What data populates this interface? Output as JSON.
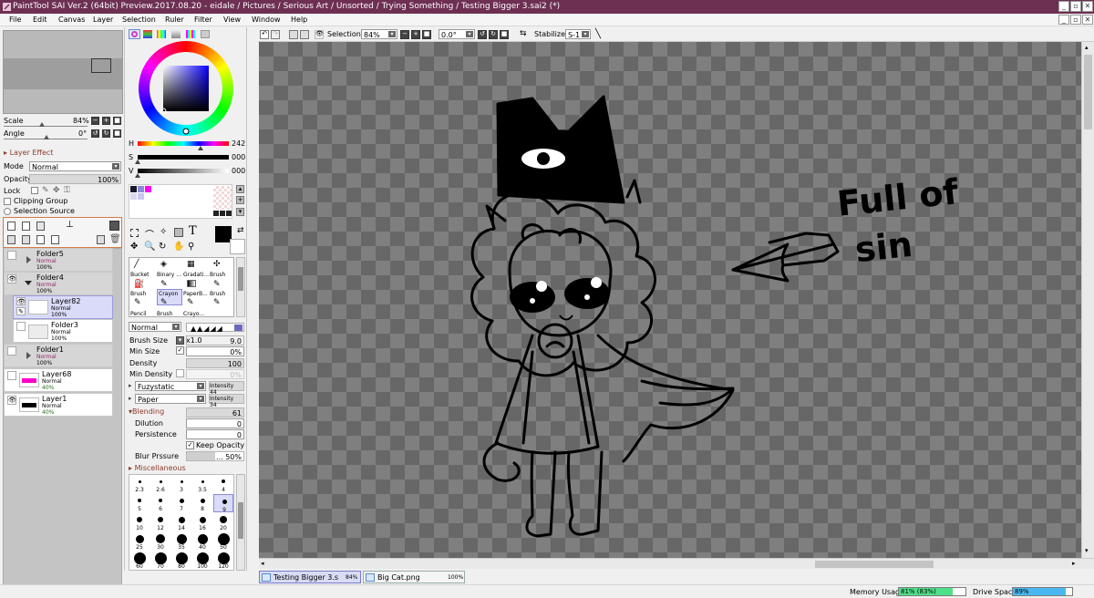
{
  "title": "PaintTool SAI Ver.2 (64bit) Preview.2017.08.20 - eidale / Pictures / Serious Art / Unsorted / Trying Something / Testing Bigger 3.sai2 (*)",
  "menu": [
    "File",
    "Edit",
    "Canvas",
    "Layer",
    "Selection",
    "Ruler",
    "Filter",
    "View",
    "Window",
    "Help"
  ],
  "navigator": {
    "scale_label": "Scale",
    "scale_value": "84%",
    "angle_label": "Angle",
    "angle_value": "0°"
  },
  "layer_effect": {
    "section": "Layer Effect",
    "mode_label": "Mode",
    "mode_value": "Normal",
    "opacity_label": "Opacity",
    "opacity_value": "100%",
    "lock_label": "Lock",
    "clipping_group": "Clipping Group",
    "selection_source": "Selection Source"
  },
  "layers": [
    {
      "name": "Folder5",
      "mode": "Normal",
      "opacity": "100%"
    },
    {
      "name": "Folder4",
      "mode": "Normal",
      "opacity": "100%"
    },
    {
      "name": "Layer82",
      "mode": "Normal",
      "opacity": "100%"
    },
    {
      "name": "Folder3",
      "mode": "Normal",
      "opacity": "100%"
    },
    {
      "name": "Folder1",
      "mode": "Normal",
      "opacity": "100%"
    },
    {
      "name": "Layer68",
      "mode": "Normal",
      "opacity": "40%"
    },
    {
      "name": "Layer1",
      "mode": "Normal",
      "opacity": "40%"
    }
  ],
  "color": {
    "h_label": "H",
    "h_value": "242",
    "s_label": "S",
    "s_value": "000",
    "v_label": "V",
    "v_value": "000",
    "swatches": [
      "#1a1a2e",
      "#8a8ad8",
      "#ff00ff",
      "#d8d8f0",
      "#c8c8f0"
    ]
  },
  "tools": {
    "row1": [
      "Bucket",
      "Binary ...",
      "Gradati...",
      "Brush"
    ],
    "row2": [
      "Brush",
      "Crayon",
      "PaperB...",
      "Brush"
    ],
    "row3": [
      "Pencil",
      "Brush",
      "Crayo..."
    ]
  },
  "brush": {
    "blend_mode": "Normal",
    "size_label": "Brush Size",
    "size_mult": "x1.0",
    "size_value": "9.0",
    "min_size_label": "Min Size",
    "min_size_value": "0%",
    "density_label": "Density",
    "density_value": "100",
    "min_density_label": "Min Density",
    "min_density_value": "0%",
    "texture1": "Fuzystatic",
    "texture1_intensity": "Intensity 44",
    "texture2": "Paper",
    "texture2_intensity": "Intensity 34",
    "blending_label": "Blending",
    "blending_value": "61",
    "dilution_label": "Dilution",
    "dilution_value": "0",
    "persistence_label": "Persistence",
    "persistence_value": "0",
    "keep_opacity": "Keep Opacity",
    "blur_label": "Blur Prssure",
    "blur_value": "... 50%",
    "misc_label": "Miscellaneous"
  },
  "brush_sizes": [
    "2.3",
    "2.6",
    "3",
    "3.5",
    "4",
    "5",
    "6",
    "7",
    "8",
    "9",
    "10",
    "12",
    "14",
    "16",
    "20",
    "25",
    "30",
    "35",
    "40",
    "50",
    "60",
    "70",
    "80",
    "100",
    "120"
  ],
  "toolbar": {
    "selection_label": "Selection",
    "zoom_value": "84%",
    "rotation_value": "0.0°",
    "stabilizer_label": "Stabilizer",
    "stabilizer_value": "S-1"
  },
  "canvas_text": [
    "Full of",
    "sin"
  ],
  "tabs": [
    {
      "name": "Testing Bigger 3.s...",
      "zoom": "84%"
    },
    {
      "name": "Big Cat.png",
      "zoom": "100%"
    }
  ],
  "status": {
    "memory_label": "Memory Usage",
    "memory_value": "81% (83%)",
    "memory_fraction": 0.81,
    "drive_label": "Drive Space",
    "drive_value": "89%",
    "drive_fraction": 0.89,
    "memory_color": "#4fe08a",
    "drive_color": "#4ab8f0"
  },
  "colors": {
    "titlebar": "#6d2f52",
    "accent_section": "#8b3a2a"
  }
}
